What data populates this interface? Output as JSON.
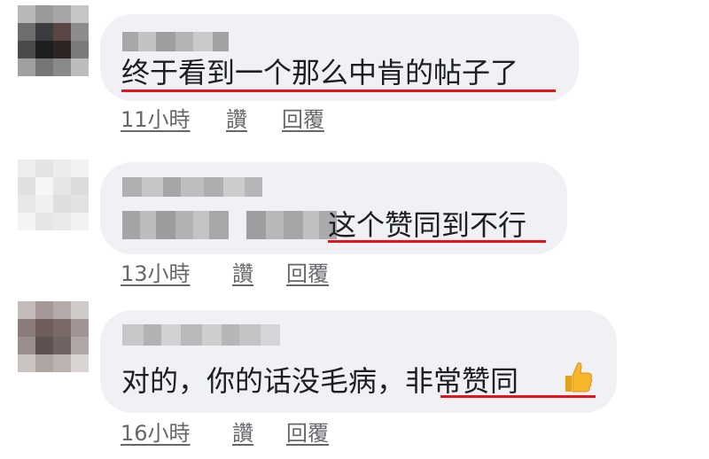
{
  "comments": [
    {
      "text": "终于看到一个那么中肯的帖子了",
      "time": "11小時",
      "like": "讚",
      "reply": "回覆"
    },
    {
      "text": "这个赞同到不行",
      "time": "13小時",
      "like": "讚",
      "reply": "回覆"
    },
    {
      "text_prefix": "对的，你的话没毛病，",
      "text_highlight": "非常赞同",
      "emoji": "thumbs-up-icon",
      "time": "16小時",
      "like": "讚",
      "reply": "回覆"
    }
  ],
  "colors": {
    "bubble": "#eff1f4",
    "text": "#1c1e21",
    "meta": "#65676b",
    "underline": "#e8131b",
    "thumb": "#f7b52c"
  }
}
